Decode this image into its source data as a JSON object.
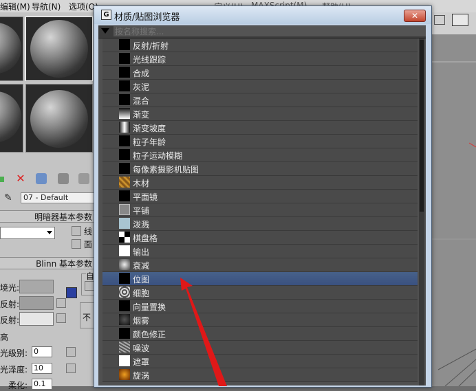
{
  "menubar": {
    "items": [
      "编辑(M)",
      "导航(N)",
      "选项(O)",
      "...定义(U)",
      "MAXScript(M)",
      "帮助(H)"
    ]
  },
  "dialog": {
    "title": "材质/贴图浏览器",
    "close_label": "✕",
    "search_placeholder": "按名称搜索...",
    "items": [
      {
        "label": "反射/折射",
        "icon": "black-swatch-icon"
      },
      {
        "label": "光线跟踪",
        "icon": "black-swatch-icon"
      },
      {
        "label": "合成",
        "icon": "black-swatch-icon"
      },
      {
        "label": "灰泥",
        "icon": "black-swatch-icon"
      },
      {
        "label": "混合",
        "icon": "black-swatch-icon"
      },
      {
        "label": "渐变",
        "icon": "gradient-icon"
      },
      {
        "label": "渐变坡度",
        "icon": "gradient-ramp-icon"
      },
      {
        "label": "粒子年龄",
        "icon": "black-swatch-icon"
      },
      {
        "label": "粒子运动模糊",
        "icon": "black-swatch-icon"
      },
      {
        "label": "每像素摄影机贴图",
        "icon": "black-swatch-icon"
      },
      {
        "label": "木材",
        "icon": "wood-icon"
      },
      {
        "label": "平面镜",
        "icon": "black-swatch-icon"
      },
      {
        "label": "平铺",
        "icon": "tiles-icon"
      },
      {
        "label": "泼溅",
        "icon": "splat-icon"
      },
      {
        "label": "棋盘格",
        "icon": "checker-icon"
      },
      {
        "label": "输出",
        "icon": "white-swatch-icon"
      },
      {
        "label": "衰减",
        "icon": "falloff-icon"
      },
      {
        "label": "位图",
        "icon": "black-swatch-icon"
      },
      {
        "label": "细胞",
        "icon": "cellular-icon"
      },
      {
        "label": "向量置换",
        "icon": "black-swatch-icon"
      },
      {
        "label": "烟雾",
        "icon": "smoke-icon"
      },
      {
        "label": "颜色修正",
        "icon": "black-swatch-icon"
      },
      {
        "label": "噪波",
        "icon": "noise-icon"
      },
      {
        "label": "遮罩",
        "icon": "white-swatch-icon"
      },
      {
        "label": "旋涡",
        "icon": "swirl-icon"
      }
    ],
    "selected_index": 17
  },
  "left_panel": {
    "material_name": "07 - Default",
    "rollout_shader": "明暗器基本参数",
    "checkbox_wire": "线",
    "checkbox_face": "面",
    "rollout_blinn": "Blinn 基本参数",
    "ambient_label": "境光:",
    "diffuse_label": "反射:",
    "specular_label": "反射:",
    "self_illum_label": "自",
    "opacity_label": "不",
    "section_label": "高",
    "spec_level_label": "光级别:",
    "spec_level_value": "0",
    "gloss_label": "光泽度:",
    "gloss_value": "10",
    "soften_label": "柔化:",
    "soften_value": "0.1"
  },
  "colors": {
    "accent_selected": "#3a5180",
    "close_button": "#c3462f",
    "arrow": "#e01818"
  }
}
